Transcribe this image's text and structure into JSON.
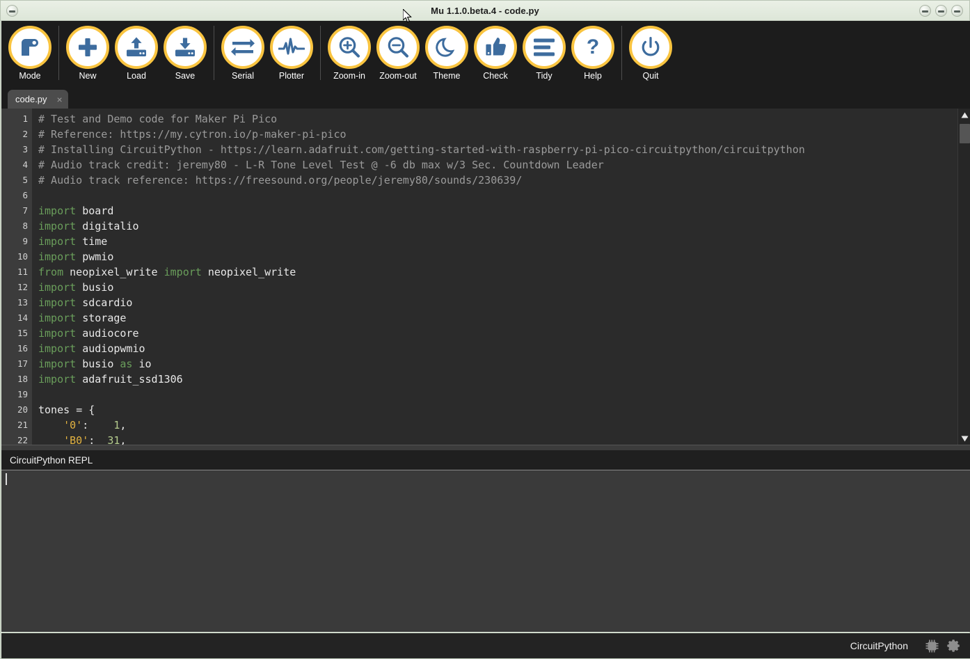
{
  "window": {
    "title": "Mu 1.1.0.beta.4 - code.py",
    "controls": {
      "left_label": "menu",
      "minimize": "minimize",
      "maximize": "maximize",
      "close": "close"
    },
    "colors": {
      "titlebar_bg": "#e4ece0",
      "toolbar_bg": "#1c1c1c",
      "icon_ring": "#f9c440",
      "icon_glyph": "#3d6c9e",
      "editor_bg": "#2b2b2b",
      "gutter_bg": "#3c3c3c",
      "repl_bg": "#3a3a3a",
      "status_bg": "#232323"
    }
  },
  "toolbar": {
    "buttons": [
      {
        "label": "Mode",
        "icon": "mode-icon"
      },
      {
        "label": "New",
        "icon": "plus-icon"
      },
      {
        "label": "Load",
        "icon": "upload-icon"
      },
      {
        "label": "Save",
        "icon": "download-icon"
      },
      {
        "label": "Serial",
        "icon": "exchange-arrows-icon"
      },
      {
        "label": "Plotter",
        "icon": "waveform-icon"
      },
      {
        "label": "Zoom-in",
        "icon": "magnifier-plus-icon"
      },
      {
        "label": "Zoom-out",
        "icon": "magnifier-minus-icon"
      },
      {
        "label": "Theme",
        "icon": "moon-icon"
      },
      {
        "label": "Check",
        "icon": "thumbs-up-icon"
      },
      {
        "label": "Tidy",
        "icon": "lines-icon"
      },
      {
        "label": "Help",
        "icon": "question-mark-icon"
      },
      {
        "label": "Quit",
        "icon": "power-icon"
      }
    ],
    "separator_after": [
      0,
      3,
      5,
      11
    ]
  },
  "tabs": [
    {
      "label": "code.py",
      "close": "×",
      "active": true
    }
  ],
  "editor": {
    "first_line": 1,
    "lines": [
      {
        "n": 1,
        "tokens": [
          {
            "t": "comment",
            "s": "# Test and Demo code for Maker Pi Pico"
          }
        ]
      },
      {
        "n": 2,
        "tokens": [
          {
            "t": "comment",
            "s": "# Reference: https://my.cytron.io/p-maker-pi-pico"
          }
        ]
      },
      {
        "n": 3,
        "tokens": [
          {
            "t": "comment",
            "s": "# Installing CircuitPython - https://learn.adafruit.com/getting-started-with-raspberry-pi-pico-circuitpython/circuitpython"
          }
        ]
      },
      {
        "n": 4,
        "tokens": [
          {
            "t": "comment",
            "s": "# Audio track credit: jeremy80 - L-R Tone Level Test @ -6 db max w/3 Sec. Countdown Leader"
          }
        ]
      },
      {
        "n": 5,
        "tokens": [
          {
            "t": "comment",
            "s": "# Audio track reference: https://freesound.org/people/jeremy80/sounds/230639/"
          }
        ]
      },
      {
        "n": 6,
        "tokens": []
      },
      {
        "n": 7,
        "tokens": [
          {
            "t": "kw",
            "s": "import"
          },
          {
            "t": "plain",
            "s": " board"
          }
        ]
      },
      {
        "n": 8,
        "tokens": [
          {
            "t": "kw",
            "s": "import"
          },
          {
            "t": "plain",
            "s": " digitalio"
          }
        ]
      },
      {
        "n": 9,
        "tokens": [
          {
            "t": "kw",
            "s": "import"
          },
          {
            "t": "plain",
            "s": " time"
          }
        ]
      },
      {
        "n": 10,
        "tokens": [
          {
            "t": "kw",
            "s": "import"
          },
          {
            "t": "plain",
            "s": " pwmio"
          }
        ]
      },
      {
        "n": 11,
        "tokens": [
          {
            "t": "kw",
            "s": "from"
          },
          {
            "t": "plain",
            "s": " neopixel_write "
          },
          {
            "t": "kw",
            "s": "import"
          },
          {
            "t": "plain",
            "s": " neopixel_write"
          }
        ]
      },
      {
        "n": 12,
        "tokens": [
          {
            "t": "kw",
            "s": "import"
          },
          {
            "t": "plain",
            "s": " busio"
          }
        ]
      },
      {
        "n": 13,
        "tokens": [
          {
            "t": "kw",
            "s": "import"
          },
          {
            "t": "plain",
            "s": " sdcardio"
          }
        ]
      },
      {
        "n": 14,
        "tokens": [
          {
            "t": "kw",
            "s": "import"
          },
          {
            "t": "plain",
            "s": " storage"
          }
        ]
      },
      {
        "n": 15,
        "tokens": [
          {
            "t": "kw",
            "s": "import"
          },
          {
            "t": "plain",
            "s": " audiocore"
          }
        ]
      },
      {
        "n": 16,
        "tokens": [
          {
            "t": "kw",
            "s": "import"
          },
          {
            "t": "plain",
            "s": " audiopwmio"
          }
        ]
      },
      {
        "n": 17,
        "tokens": [
          {
            "t": "kw",
            "s": "import"
          },
          {
            "t": "plain",
            "s": " busio "
          },
          {
            "t": "kw",
            "s": "as"
          },
          {
            "t": "plain",
            "s": " io"
          }
        ]
      },
      {
        "n": 18,
        "tokens": [
          {
            "t": "kw",
            "s": "import"
          },
          {
            "t": "plain",
            "s": " adafruit_ssd1306"
          }
        ]
      },
      {
        "n": 19,
        "tokens": []
      },
      {
        "n": 20,
        "tokens": [
          {
            "t": "plain",
            "s": "tones "
          },
          {
            "t": "op",
            "s": "="
          },
          {
            "t": "plain",
            "s": " {"
          }
        ]
      },
      {
        "n": 21,
        "tokens": [
          {
            "t": "plain",
            "s": "    "
          },
          {
            "t": "str",
            "s": "'0'"
          },
          {
            "t": "plain",
            "s": ":    "
          },
          {
            "t": "num",
            "s": "1"
          },
          {
            "t": "plain",
            "s": ","
          }
        ]
      },
      {
        "n": 22,
        "tokens": [
          {
            "t": "plain",
            "s": "    "
          },
          {
            "t": "str",
            "s": "'B0'"
          },
          {
            "t": "plain",
            "s": ":  "
          },
          {
            "t": "num",
            "s": "31"
          },
          {
            "t": "plain",
            "s": ","
          }
        ]
      }
    ],
    "scrollbar": {
      "up": "scroll-up-arrow",
      "down": "scroll-down-arrow",
      "thumb_top_pct": 4
    }
  },
  "repl": {
    "title": "CircuitPython REPL",
    "content": ""
  },
  "statusbar": {
    "mode": "CircuitPython",
    "icons": [
      {
        "name": "chip-icon"
      },
      {
        "name": "gear-icon"
      }
    ]
  }
}
